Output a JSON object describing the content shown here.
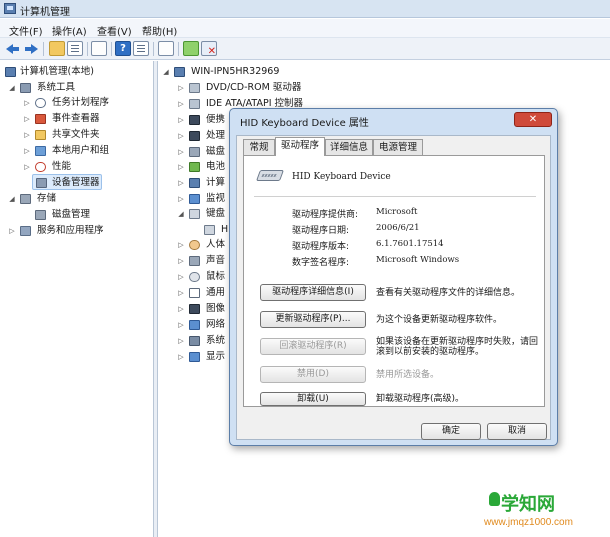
{
  "window": {
    "title": "计算机管理"
  },
  "menu": [
    "文件(F)",
    "操作(A)",
    "查看(V)",
    "帮助(H)"
  ],
  "left_tree": {
    "root": "计算机管理(本地)",
    "items": [
      "系统工具",
      "任务计划程序",
      "事件查看器",
      "共享文件夹",
      "本地用户和组",
      "性能",
      "设备管理器",
      "存储",
      "磁盘管理",
      "服务和应用程序"
    ]
  },
  "device_tree": {
    "computer": "WIN-IPN5HR32969",
    "categories": [
      "DVD/CD-ROM 驱动器",
      "IDE ATA/ATAPI 控制器",
      "便携",
      "处理",
      "磁盘",
      "电池",
      "计算",
      "监视",
      "键盘",
      "H",
      "人体",
      "声音",
      "鼠标",
      "通用",
      "图像",
      "网络",
      "系统",
      "显示"
    ]
  },
  "dialog": {
    "title": "HID Keyboard Device 属性",
    "close_label": "✕",
    "tabs": [
      "常规",
      "驱动程序",
      "详细信息",
      "电源管理"
    ],
    "device_name": "HID Keyboard Device",
    "properties": [
      {
        "label": "驱动程序提供商:",
        "value": "Microsoft"
      },
      {
        "label": "驱动程序日期:",
        "value": "2006/6/21"
      },
      {
        "label": "驱动程序版本:",
        "value": "6.1.7601.17514"
      },
      {
        "label": "数字签名程序:",
        "value": "Microsoft Windows"
      }
    ],
    "actions": [
      {
        "button": "驱动程序详细信息(I)",
        "desc": "查看有关驱动程序文件的详细信息。"
      },
      {
        "button": "更新驱动程序(P)...",
        "desc": "为这个设备更新驱动程序软件。"
      },
      {
        "button": "回滚驱动程序(R)",
        "desc": "如果该设备在更新驱动程序时失败，请回滚到以前安装的驱动程序。"
      },
      {
        "button": "禁用(D)",
        "desc": "禁用所选设备。"
      },
      {
        "button": "卸载(U)",
        "desc": "卸载驱动程序(高级)。"
      }
    ],
    "ok_label": "确定",
    "cancel_label": "取消"
  },
  "watermark": {
    "title": "学知网",
    "url": "www.jmqz1000.com"
  }
}
